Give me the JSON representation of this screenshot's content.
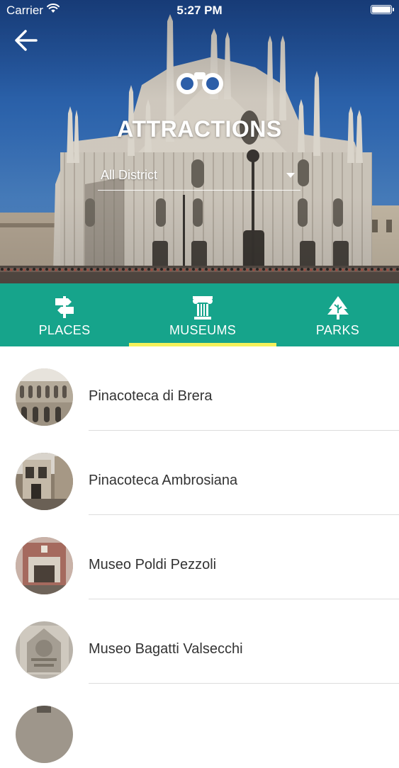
{
  "status_bar": {
    "carrier": "Carrier",
    "time": "5:27 PM",
    "wifi_icon": "wifi-icon",
    "battery_icon": "battery-icon"
  },
  "header": {
    "back_icon": "arrow-left-icon",
    "title_icon": "binoculars-icon",
    "title": "ATTRACTIONS",
    "district_filter": {
      "selected": "All District",
      "caret_icon": "caret-down-icon"
    }
  },
  "tabs": [
    {
      "label": "PLACES",
      "icon": "signpost-icon",
      "active": false
    },
    {
      "label": "MUSEUMS",
      "icon": "column-icon",
      "active": true
    },
    {
      "label": "PARKS",
      "icon": "tree-icon",
      "active": false
    }
  ],
  "list": {
    "items": [
      {
        "title": "Pinacoteca di Brera"
      },
      {
        "title": "Pinacoteca Ambrosiana"
      },
      {
        "title": "Museo Poldi Pezzoli"
      },
      {
        "title": "Museo Bagatti Valsecchi"
      }
    ]
  },
  "colors": {
    "accent": "#16a48b",
    "tab_indicator": "#f4f15a",
    "text": "#333333",
    "divider": "#dddddd"
  }
}
